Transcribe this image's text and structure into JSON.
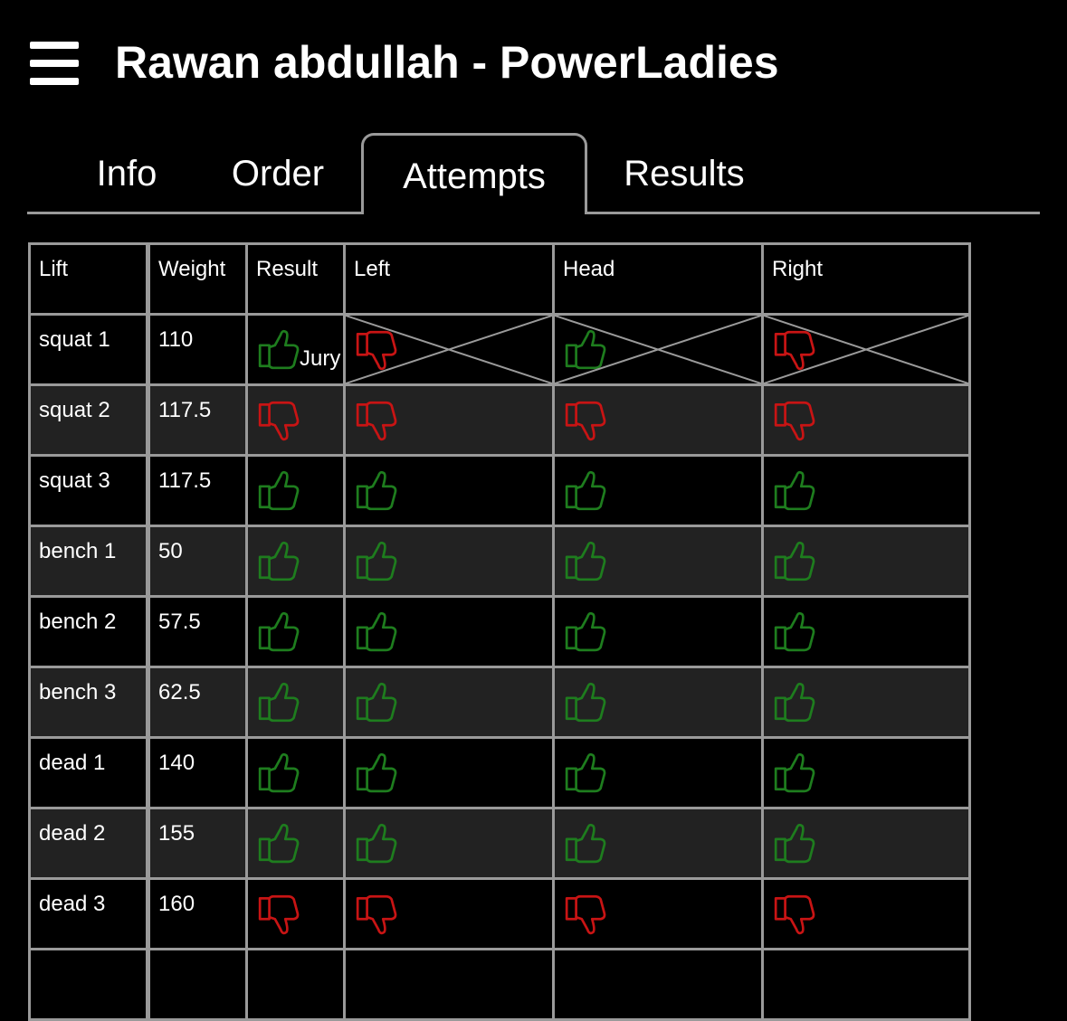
{
  "header": {
    "title": "Rawan abdullah - PowerLadies",
    "menu_icon": "hamburger-menu-icon"
  },
  "tabs": [
    {
      "label": "Info",
      "active": false
    },
    {
      "label": "Order",
      "active": false
    },
    {
      "label": "Attempts",
      "active": true
    },
    {
      "label": "Results",
      "active": false
    }
  ],
  "table": {
    "headers": [
      "Lift",
      "Weight",
      "Result",
      "Left",
      "Head",
      "Right"
    ],
    "rows": [
      {
        "lift": "squat 1",
        "weight": "110",
        "result": "good",
        "result_note": "Jury",
        "left": "bad",
        "head": "good",
        "right": "bad",
        "overruled": true
      },
      {
        "lift": "squat 2",
        "weight": "117.5",
        "result": "bad",
        "left": "bad",
        "head": "bad",
        "right": "bad"
      },
      {
        "lift": "squat 3",
        "weight": "117.5",
        "result": "good",
        "left": "good",
        "head": "good",
        "right": "good"
      },
      {
        "lift": "bench 1",
        "weight": "50",
        "result": "good",
        "left": "good",
        "head": "good",
        "right": "good"
      },
      {
        "lift": "bench 2",
        "weight": "57.5",
        "result": "good",
        "left": "good",
        "head": "good",
        "right": "good"
      },
      {
        "lift": "bench 3",
        "weight": "62.5",
        "result": "good",
        "left": "good",
        "head": "good",
        "right": "good"
      },
      {
        "lift": "dead 1",
        "weight": "140",
        "result": "good",
        "left": "good",
        "head": "good",
        "right": "good"
      },
      {
        "lift": "dead 2",
        "weight": "155",
        "result": "good",
        "left": "good",
        "head": "good",
        "right": "good"
      },
      {
        "lift": "dead 3",
        "weight": "160",
        "result": "bad",
        "left": "bad",
        "head": "bad",
        "right": "bad"
      }
    ]
  },
  "colors": {
    "good": "#1e7d1e",
    "bad": "#c81414",
    "border": "#9a9a9a",
    "alt_row": "#222222"
  },
  "icons": {
    "good": "thumbs-up-icon",
    "bad": "thumbs-down-icon"
  }
}
